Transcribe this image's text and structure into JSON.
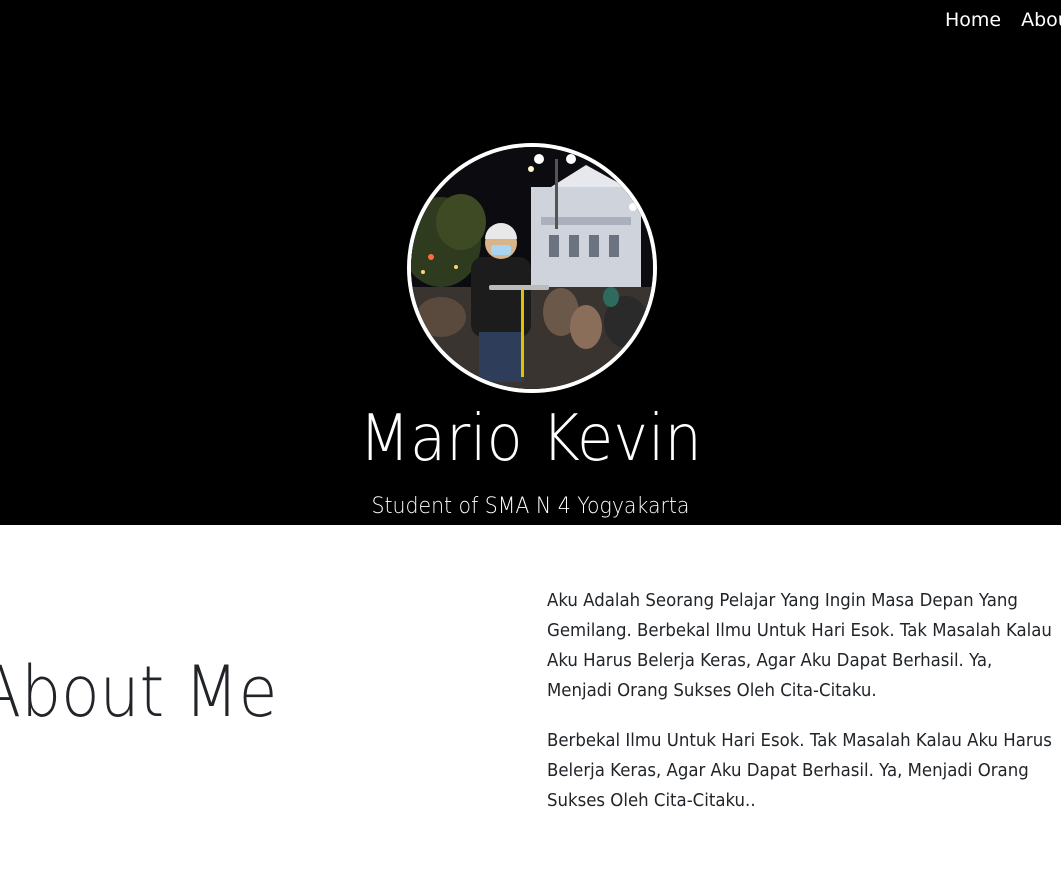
{
  "nav": {
    "items": [
      {
        "label": "Home"
      },
      {
        "label": "About"
      }
    ]
  },
  "hero": {
    "name": "Mario Kevin",
    "subtitle": "Student of SMA N 4 Yogyakarta"
  },
  "about": {
    "title": "About Me",
    "paragraphs": [
      "Aku Adalah Seorang Pelajar Yang Ingin Masa Depan Yang Gemilang. Berbekal Ilmu Untuk Hari Esok. Tak Masalah Kalau Aku Harus Belerja Keras, Agar Aku Dapat Berhasil. Ya, Menjadi Orang Sukses Oleh Cita-Citaku.",
      "Berbekal Ilmu Untuk Hari Esok. Tak Masalah Kalau Aku Harus Belerja Keras, Agar Aku Dapat Berhasil. Ya, Menjadi Orang Sukses Oleh Cita-Citaku.."
    ]
  },
  "colors": {
    "hero_background": "#000000",
    "hero_text": "#ffffff",
    "body_text": "#212529",
    "page_background": "#ffffff"
  }
}
